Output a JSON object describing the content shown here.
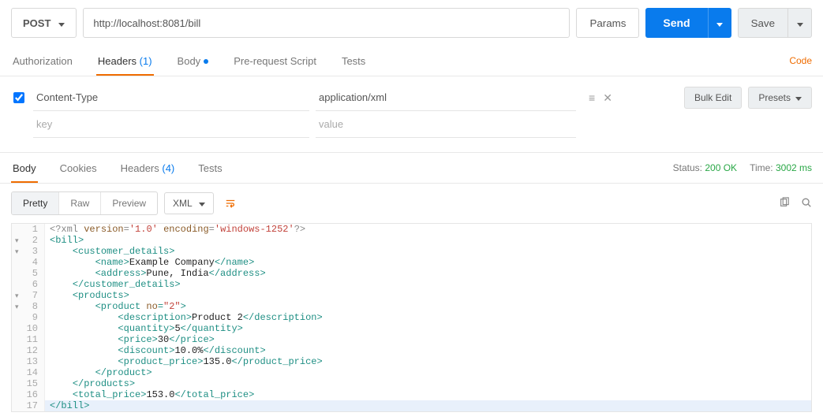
{
  "request": {
    "method": "POST",
    "url": "http://localhost:8081/bill",
    "params_label": "Params",
    "send_label": "Send",
    "save_label": "Save"
  },
  "req_tabs": {
    "authorization": "Authorization",
    "headers": "Headers",
    "headers_count": "(1)",
    "body": "Body",
    "prerequest": "Pre-request Script",
    "tests": "Tests",
    "code_link": "Code"
  },
  "headers_editor": {
    "rows": [
      {
        "checked": true,
        "key": "Content-Type",
        "value": "application/xml"
      }
    ],
    "placeholder_key": "key",
    "placeholder_value": "value",
    "bulk_edit": "Bulk Edit",
    "presets": "Presets"
  },
  "resp_tabs": {
    "body": "Body",
    "cookies": "Cookies",
    "headers": "Headers",
    "headers_count": "(4)",
    "tests": "Tests"
  },
  "status": {
    "status_label": "Status:",
    "status_value": "200 OK",
    "time_label": "Time:",
    "time_value": "3002 ms"
  },
  "viewer": {
    "pretty": "Pretty",
    "raw": "Raw",
    "preview": "Preview",
    "format": "XML"
  },
  "code_lines": [
    {
      "n": 1,
      "fold": false,
      "indent": 0,
      "segs": [
        {
          "cls": "c-decl",
          "t": "<?xml "
        },
        {
          "cls": "c-attr",
          "t": "version"
        },
        {
          "cls": "c-decl",
          "t": "="
        },
        {
          "cls": "c-str",
          "t": "'1.0'"
        },
        {
          "cls": "c-decl",
          "t": " "
        },
        {
          "cls": "c-attr",
          "t": "encoding"
        },
        {
          "cls": "c-decl",
          "t": "="
        },
        {
          "cls": "c-str",
          "t": "'windows-1252'"
        },
        {
          "cls": "c-decl",
          "t": "?>"
        }
      ]
    },
    {
      "n": 2,
      "fold": true,
      "indent": 0,
      "segs": [
        {
          "cls": "c-tag",
          "t": "<bill>"
        }
      ]
    },
    {
      "n": 3,
      "fold": true,
      "indent": 1,
      "segs": [
        {
          "cls": "c-tag",
          "t": "<customer_details>"
        }
      ]
    },
    {
      "n": 4,
      "fold": false,
      "indent": 2,
      "segs": [
        {
          "cls": "c-tag",
          "t": "<name>"
        },
        {
          "cls": "c-txt",
          "t": "Example Company"
        },
        {
          "cls": "c-tag",
          "t": "</name>"
        }
      ]
    },
    {
      "n": 5,
      "fold": false,
      "indent": 2,
      "segs": [
        {
          "cls": "c-tag",
          "t": "<address>"
        },
        {
          "cls": "c-txt",
          "t": "Pune, India"
        },
        {
          "cls": "c-tag",
          "t": "</address>"
        }
      ]
    },
    {
      "n": 6,
      "fold": false,
      "indent": 1,
      "segs": [
        {
          "cls": "c-tag",
          "t": "</customer_details>"
        }
      ]
    },
    {
      "n": 7,
      "fold": true,
      "indent": 1,
      "segs": [
        {
          "cls": "c-tag",
          "t": "<products>"
        }
      ]
    },
    {
      "n": 8,
      "fold": true,
      "indent": 2,
      "segs": [
        {
          "cls": "c-tag",
          "t": "<product "
        },
        {
          "cls": "c-attr",
          "t": "no"
        },
        {
          "cls": "c-tag",
          "t": "="
        },
        {
          "cls": "c-str",
          "t": "\"2\""
        },
        {
          "cls": "c-tag",
          "t": ">"
        }
      ]
    },
    {
      "n": 9,
      "fold": false,
      "indent": 3,
      "segs": [
        {
          "cls": "c-tag",
          "t": "<description>"
        },
        {
          "cls": "c-txt",
          "t": "Product 2"
        },
        {
          "cls": "c-tag",
          "t": "</description>"
        }
      ]
    },
    {
      "n": 10,
      "fold": false,
      "indent": 3,
      "segs": [
        {
          "cls": "c-tag",
          "t": "<quantity>"
        },
        {
          "cls": "c-txt",
          "t": "5"
        },
        {
          "cls": "c-tag",
          "t": "</quantity>"
        }
      ]
    },
    {
      "n": 11,
      "fold": false,
      "indent": 3,
      "segs": [
        {
          "cls": "c-tag",
          "t": "<price>"
        },
        {
          "cls": "c-txt",
          "t": "30"
        },
        {
          "cls": "c-tag",
          "t": "</price>"
        }
      ]
    },
    {
      "n": 12,
      "fold": false,
      "indent": 3,
      "segs": [
        {
          "cls": "c-tag",
          "t": "<discount>"
        },
        {
          "cls": "c-txt",
          "t": "10.0%"
        },
        {
          "cls": "c-tag",
          "t": "</discount>"
        }
      ]
    },
    {
      "n": 13,
      "fold": false,
      "indent": 3,
      "segs": [
        {
          "cls": "c-tag",
          "t": "<product_price>"
        },
        {
          "cls": "c-txt",
          "t": "135.0"
        },
        {
          "cls": "c-tag",
          "t": "</product_price>"
        }
      ]
    },
    {
      "n": 14,
      "fold": false,
      "indent": 2,
      "segs": [
        {
          "cls": "c-tag",
          "t": "</product>"
        }
      ]
    },
    {
      "n": 15,
      "fold": false,
      "indent": 1,
      "segs": [
        {
          "cls": "c-tag",
          "t": "</products>"
        }
      ]
    },
    {
      "n": 16,
      "fold": false,
      "indent": 1,
      "segs": [
        {
          "cls": "c-tag",
          "t": "<total_price>"
        },
        {
          "cls": "c-txt",
          "t": "153.0"
        },
        {
          "cls": "c-tag",
          "t": "</total_price>"
        }
      ]
    },
    {
      "n": 17,
      "fold": false,
      "indent": 0,
      "hl": true,
      "segs": [
        {
          "cls": "c-tag",
          "t": "</bill>"
        }
      ]
    }
  ]
}
